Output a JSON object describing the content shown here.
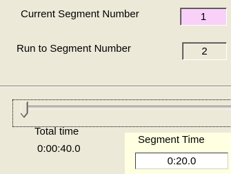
{
  "current_segment": {
    "label": "Current Segment Number",
    "value": "1",
    "value_bg": "#f8d0f8"
  },
  "run_to_segment": {
    "label": "Run to Segment Number",
    "value": "2"
  },
  "slider": {
    "level": 0.0
  },
  "total_time": {
    "label": "Total time",
    "value": "0:00:40.0"
  },
  "segment_time": {
    "label": "Segment Time",
    "value": "0:20.0",
    "panel_bg": "#ffffe1"
  }
}
